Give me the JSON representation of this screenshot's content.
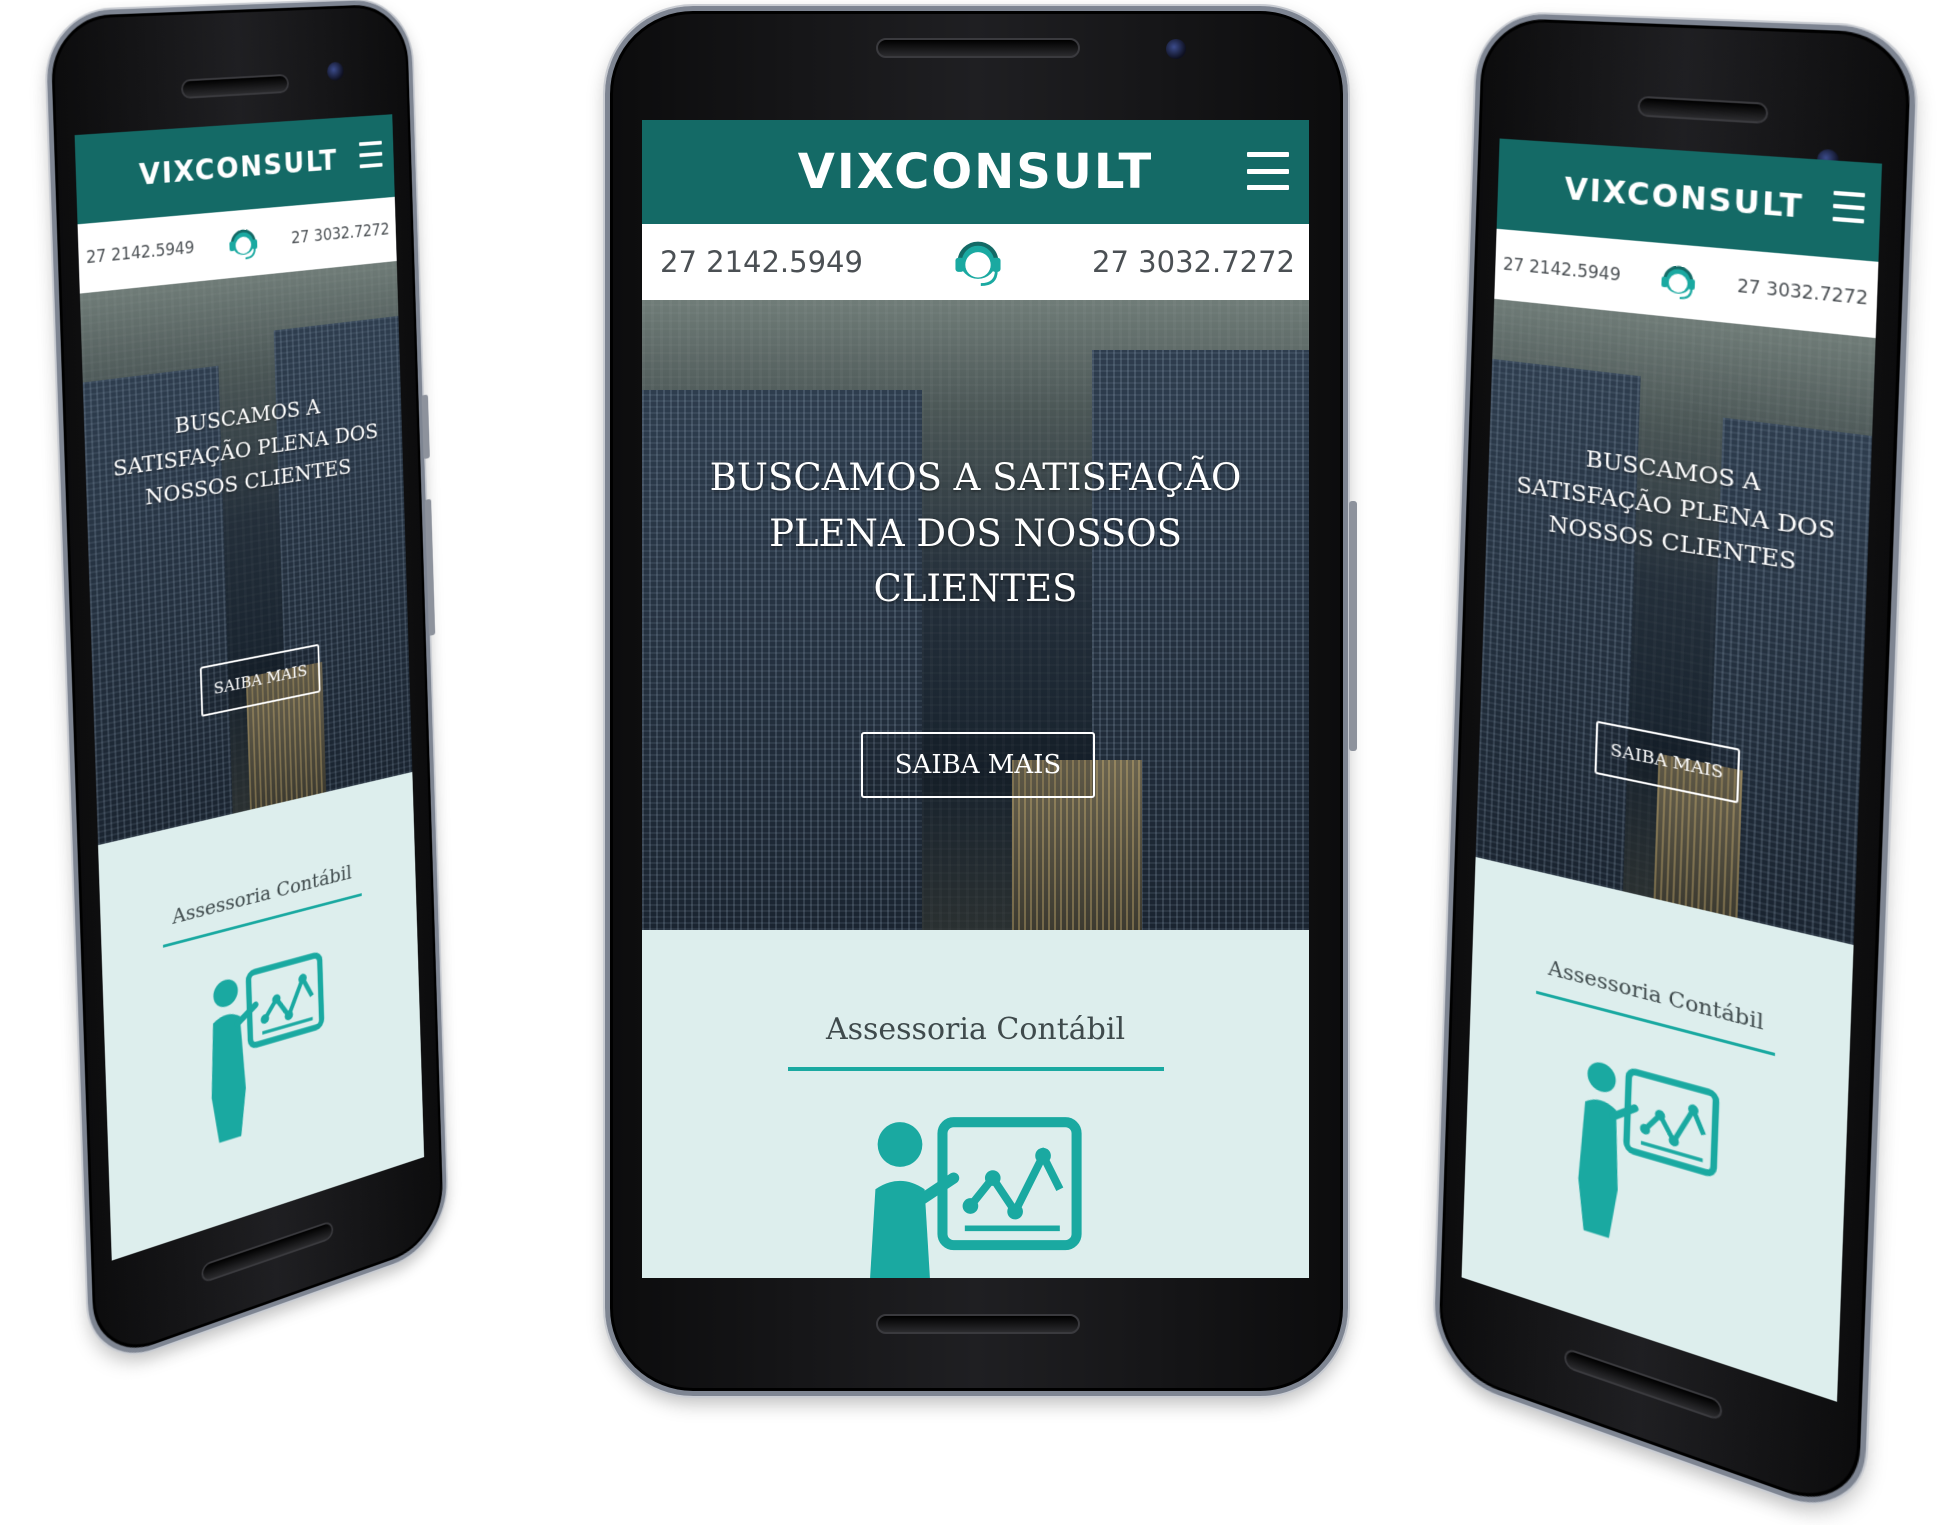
{
  "site": {
    "brand": "VIXCONSULT",
    "phone_left": "27 2142.5949",
    "phone_right": "27 3032.7272",
    "headline": "BUSCAMOS A SATISFAÇÃO PLENA DOS NOSSOS CLIENTES",
    "cta_label": "SAIBA MAIS",
    "service_title": "Assessoria Contábil"
  },
  "icons": {
    "menu": "hamburger-menu-icon",
    "contact": "headset-support-icon",
    "service": "presenter-chart-icon"
  },
  "colors": {
    "header": "#146a66",
    "accent": "#1aa9a1",
    "section_bg": "#ddeeed",
    "text_dark": "#4b5054"
  }
}
